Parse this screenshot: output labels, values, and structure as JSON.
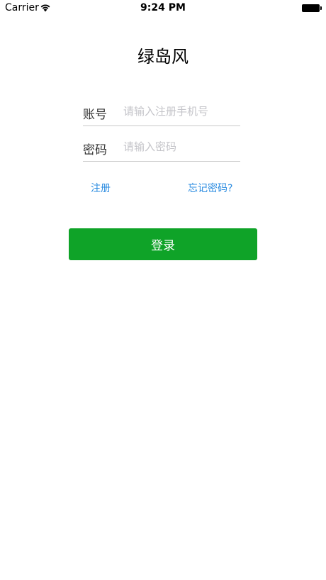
{
  "status_bar": {
    "carrier": "Carrier",
    "time": "9:24 PM"
  },
  "app": {
    "title": "绿岛风"
  },
  "form": {
    "account": {
      "label": "账号",
      "placeholder": "请输入注册手机号",
      "value": ""
    },
    "password": {
      "label": "密码",
      "placeholder": "请输入密码",
      "value": ""
    }
  },
  "links": {
    "register": "注册",
    "forgot_password": "忘记密码?"
  },
  "actions": {
    "login_label": "登录"
  },
  "colors": {
    "accent": "#0fa328",
    "link": "#2a8be0",
    "divider": "#c8c8c8"
  }
}
